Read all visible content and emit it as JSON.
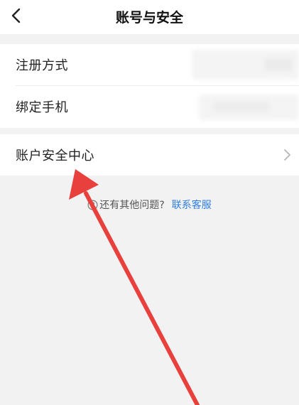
{
  "header": {
    "title": "账号与安全",
    "back_icon": "chevron-left-icon"
  },
  "account_group": {
    "items": [
      {
        "label": "注册方式"
      },
      {
        "label": "绑定手机"
      }
    ]
  },
  "security_group": {
    "items": [
      {
        "label": "账户安全中心",
        "trailing_icon": "chevron-right-icon"
      }
    ]
  },
  "help": {
    "icon": "question-circle-icon",
    "text": "还有其他问题?",
    "link_label": "联系客服"
  },
  "colors": {
    "link": "#2f7de1",
    "annotation_arrow": "#e8413d",
    "page_background": "#f2f2f2"
  }
}
